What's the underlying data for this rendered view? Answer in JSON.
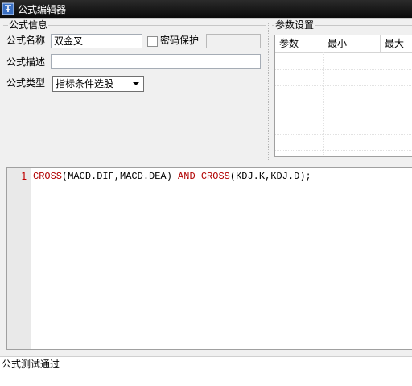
{
  "window": {
    "title": "公式编辑器"
  },
  "formula_info": {
    "section_title": "公式信息",
    "name_label": "公式名称",
    "name_value": "双金叉",
    "password_label": "密码保护",
    "desc_label": "公式描述",
    "desc_value": "",
    "type_label": "公式类型",
    "type_value": "指标条件选股"
  },
  "params": {
    "section_title": "参数设置",
    "columns": [
      "参数",
      "最小",
      "最大"
    ]
  },
  "editor": {
    "line_number": "1",
    "code_tokens": [
      {
        "text": "CROSS",
        "style": "kw"
      },
      {
        "text": "(MACD.DIF,MACD.DEA) ",
        "style": "plain"
      },
      {
        "text": "AND",
        "style": "kw"
      },
      {
        "text": " ",
        "style": "plain"
      },
      {
        "text": "CROSS",
        "style": "kw"
      },
      {
        "text": "(KDJ.K,KDJ.D);",
        "style": "plain"
      }
    ]
  },
  "status": {
    "message": "公式测试通过"
  }
}
